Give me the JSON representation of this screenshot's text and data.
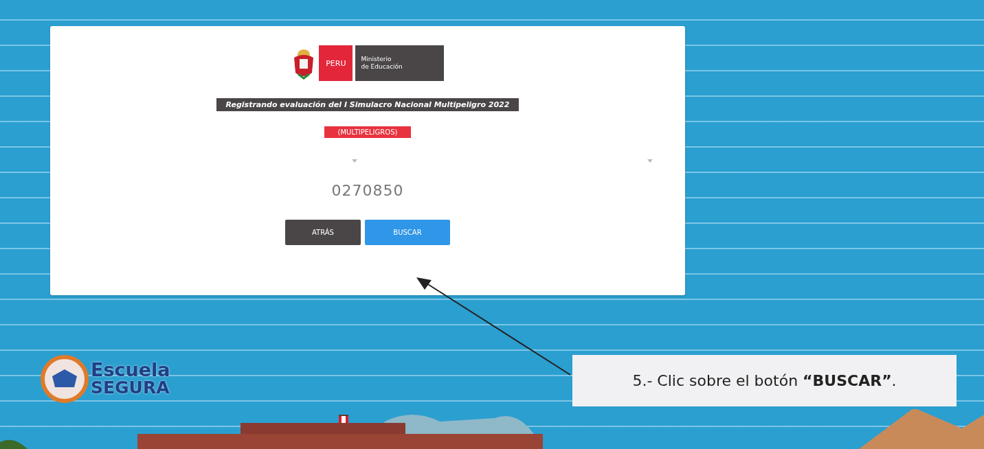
{
  "header": {
    "country": "PERU",
    "ministry_line_1": "Ministerio",
    "ministry_line_2": "de Educación"
  },
  "title": "Registrando evaluación del I Simulacro Nacional Multipeligro 2022",
  "badge": "(MULTIPELIGROS)",
  "code": "0270850",
  "buttons": [
    {
      "label": "ATRÁS",
      "kind": "back"
    },
    {
      "label": "BUSCAR",
      "kind": "primary"
    }
  ],
  "brand": {
    "line_1": "Escuela",
    "line_2": "SEGURA"
  },
  "callout": "5.- Clic sobre el botón **“BUSCAR”**."
}
